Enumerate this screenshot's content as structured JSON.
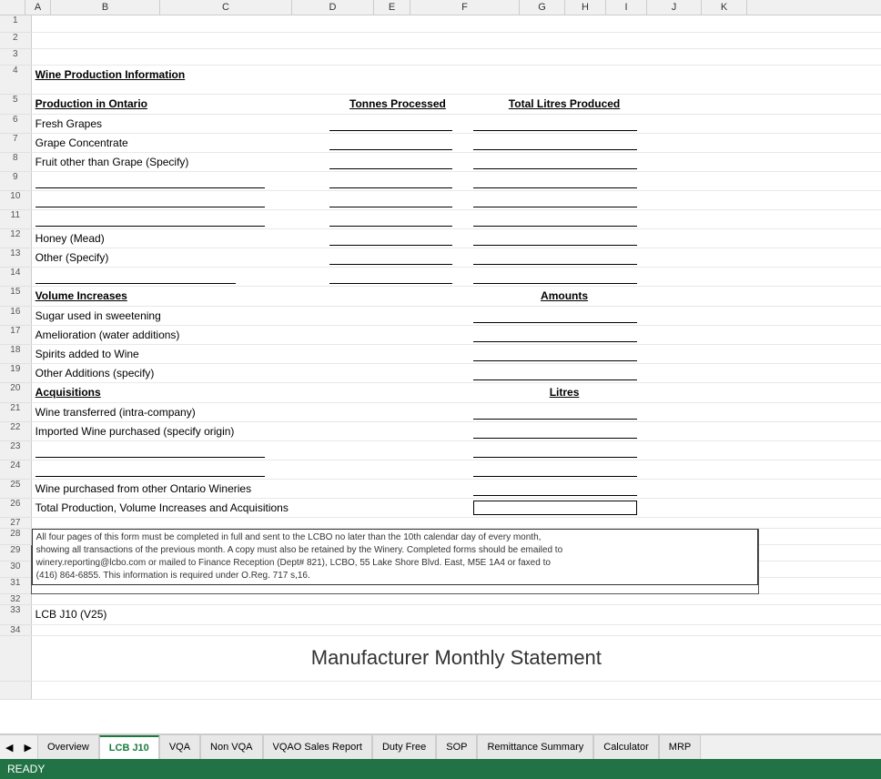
{
  "title": "Wine Production Information",
  "subtitle": "Manufacturer Monthly Statement",
  "columns": {
    "headers": [
      "A",
      "B",
      "C",
      "D",
      "E",
      "F",
      "G",
      "H",
      "I",
      "J",
      "K"
    ]
  },
  "rows": {
    "row4": {
      "num": "4",
      "content": "Wine Production Information"
    },
    "row5": {
      "num": "5",
      "col_b": "Production in Ontario",
      "col_d": "Tonnes Processed",
      "col_f": "Total Litres Produced"
    },
    "row6": {
      "num": "6",
      "col_b": "Fresh Grapes"
    },
    "row7": {
      "num": "7",
      "col_b": "Grape Concentrate"
    },
    "row8": {
      "num": "8",
      "col_b": "Fruit other than Grape (Specify)"
    },
    "row9": {
      "num": "9"
    },
    "row10": {
      "num": "10"
    },
    "row11": {
      "num": "11"
    },
    "row12": {
      "num": "12",
      "col_b": "Honey (Mead)"
    },
    "row13": {
      "num": "13",
      "col_b": "Other (Specify)"
    },
    "row14": {
      "num": "14"
    },
    "row15": {
      "num": "15",
      "col_b": "Volume Increases",
      "col_f": "Amounts"
    },
    "row16": {
      "num": "16",
      "col_b": "Sugar used in sweetening"
    },
    "row17": {
      "num": "17",
      "col_b": "Amelioration (water additions)"
    },
    "row18": {
      "num": "18",
      "col_b": "Spirits added to Wine"
    },
    "row19": {
      "num": "19",
      "col_b": "Other Additions (specify)"
    },
    "row20": {
      "num": "20",
      "col_b": "Acquisitions",
      "col_f": "Litres"
    },
    "row21": {
      "num": "21",
      "col_b": "Wine transferred (intra-company)"
    },
    "row22": {
      "num": "22",
      "col_b": "Imported Wine purchased (specify origin)"
    },
    "row23": {
      "num": "23"
    },
    "row24": {
      "num": "24"
    },
    "row25": {
      "num": "25",
      "col_b": "Wine purchased from other Ontario Wineries"
    },
    "row26": {
      "num": "26",
      "col_b": "Total Production, Volume Increases and Acquisitions"
    },
    "row27": {
      "num": "27"
    },
    "row28": {
      "num": "28",
      "notice": "All four pages of this form must be completed in full and sent to the LCBO no later than the 10th calendar day of every month,"
    },
    "row29": {
      "num": "29",
      "notice": "showing all transactions of the previous month. A copy must also be retained by the Winery. Completed forms should be emailed to"
    },
    "row30": {
      "num": "30",
      "notice": "winery.reporting@lcbo.com or mailed to Finance Reception (Dept# 821), LCBO, 55 Lake Shore Blvd. East, M5E 1A4 or faxed to"
    },
    "row31": {
      "num": "31",
      "notice": "(416) 864-6855. This information is required under O.Reg. 717 s,16."
    },
    "row32": {
      "num": "32"
    },
    "row33": {
      "num": "33",
      "col_b": "LCB J10 (V25)"
    }
  },
  "tabs": [
    {
      "label": "Overview",
      "active": false
    },
    {
      "label": "LCB J10",
      "active": true
    },
    {
      "label": "VQA",
      "active": false
    },
    {
      "label": "Non VQA",
      "active": false
    },
    {
      "label": "VQAO Sales Report",
      "active": false
    },
    {
      "label": "Duty Free",
      "active": false
    },
    {
      "label": "SOP",
      "active": false
    },
    {
      "label": "Remittance Summary",
      "active": false
    },
    {
      "label": "Calculator",
      "active": false
    },
    {
      "label": "MRP",
      "active": false
    }
  ],
  "status": {
    "label": "READY"
  }
}
